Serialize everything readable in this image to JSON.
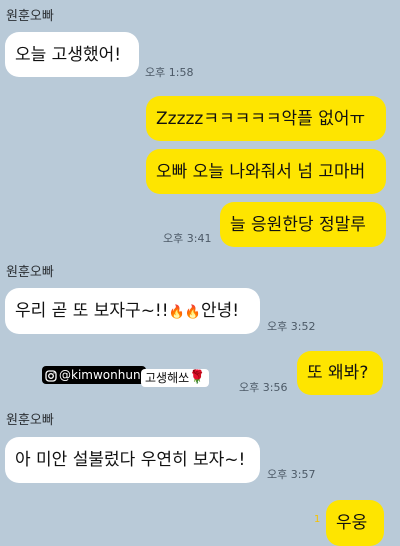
{
  "chat": {
    "group1": {
      "sender": "원훈오빠",
      "messages": [
        {
          "text": "오늘 고생했어!"
        }
      ],
      "time": "오후 1:58"
    },
    "group2": {
      "messages": [
        {
          "text": "Zzzzzㅋㅋㅋㅋㅋ악플 없어ㅠ"
        },
        {
          "text": "오빠 오늘 나와줘서 넘 고마버"
        },
        {
          "text": "늘 응원한당 정말루"
        }
      ],
      "time": "오후 3:41"
    },
    "group3": {
      "sender": "원훈오빠",
      "message_text": "우리 곧 또 보자구~!!",
      "message_emoji": "🔥🔥",
      "message_suffix": "안녕!",
      "time": "오후 3:52"
    },
    "sticker": {
      "handle": "@kimwonhun",
      "caption": "고생해쏘",
      "caption_emoji": "🌹"
    },
    "group4": {
      "message": "또 왜봐?",
      "time": "오후 3:56"
    },
    "group5": {
      "sender": "원훈오빠",
      "message": "아 미안 설불렀다 우연히 보자~!",
      "time": "오후 3:57"
    },
    "group6": {
      "unread": "1",
      "message": "우웅"
    }
  },
  "colors": {
    "background": "#b9cad8",
    "incoming_bubble": "#ffffff",
    "outgoing_bubble": "#fee500",
    "unread": "#f6c300"
  }
}
